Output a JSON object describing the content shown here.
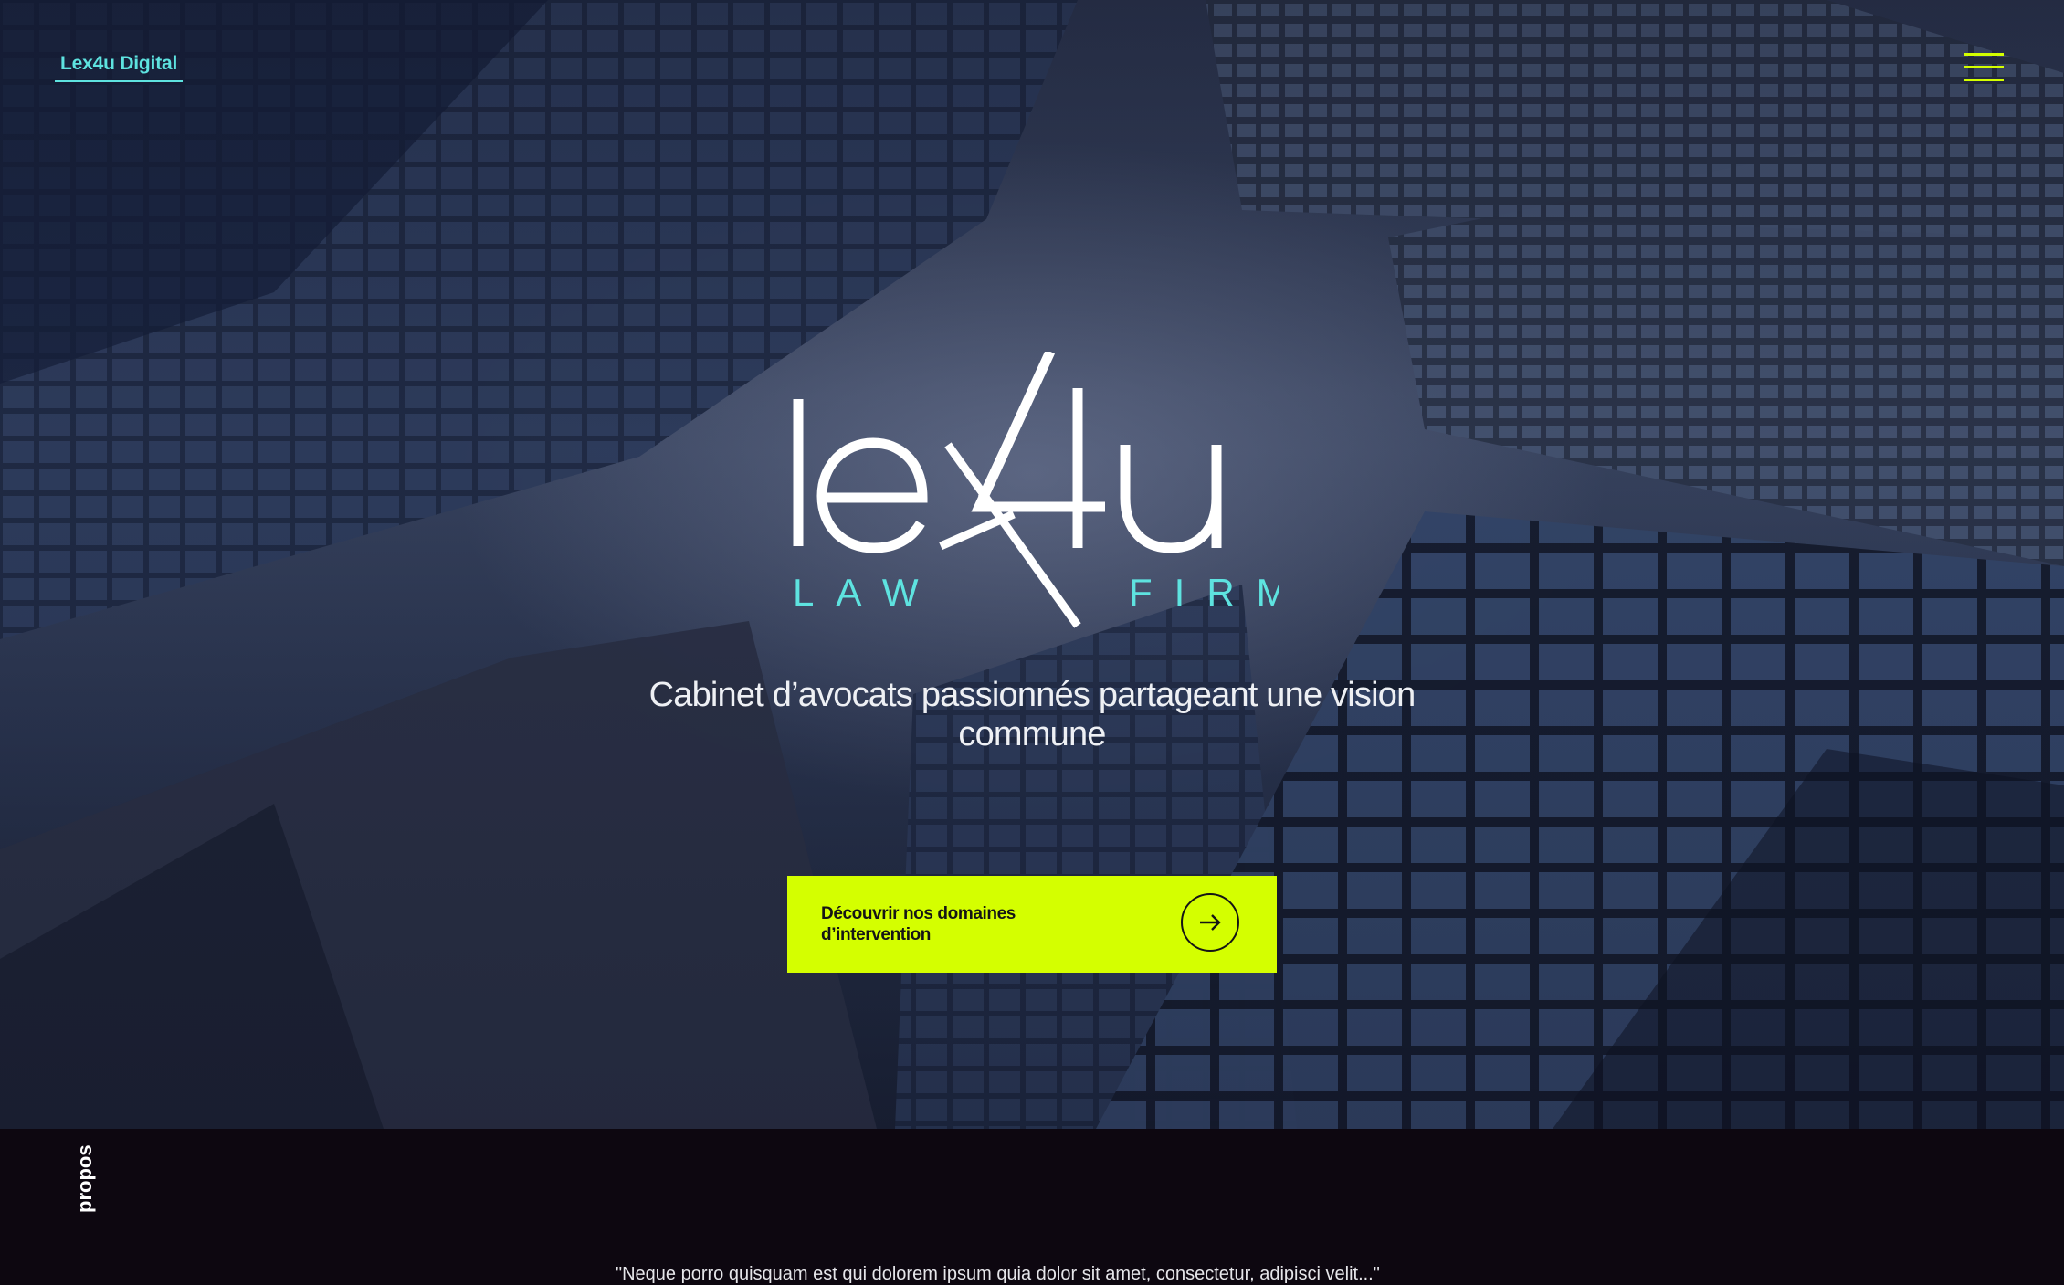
{
  "header": {
    "brand": "Lex4u Digital",
    "menu_icon": "hamburger-menu-icon"
  },
  "hero": {
    "logo": {
      "wordmark": "lex4u",
      "left_word": "LAW",
      "right_word": "FIRM"
    },
    "tagline": "Cabinet d’avocats passionnés partageant une vision commune",
    "cta": {
      "label": "Découvrir nos domaines d’intervention",
      "icon": "arrow-right-icon"
    }
  },
  "about": {
    "side_label": "propos",
    "quote": "\"Neque porro quisquam est qui dolorem ipsum quia dolor sit amet, consectetur, adipisci velit...\""
  },
  "colors": {
    "accent": "#d4ff00",
    "brand_cyan": "#5ee3e0",
    "dark": "#0d0710"
  }
}
